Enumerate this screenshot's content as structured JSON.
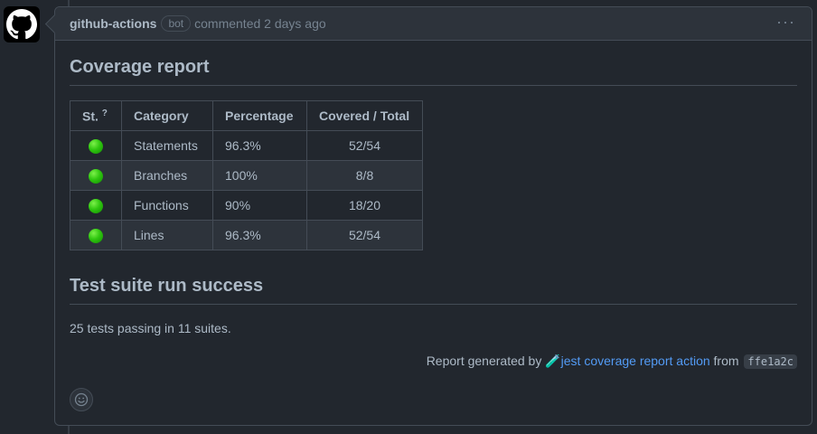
{
  "comment": {
    "author": "github-actions",
    "badge": "bot",
    "meta": "commented 2 days ago",
    "menu_label": "···"
  },
  "coverage": {
    "title": "Coverage report",
    "headers": {
      "status": "St.",
      "status_help": "?",
      "category": "Category",
      "percentage": "Percentage",
      "covered_total": "Covered / Total"
    },
    "rows": [
      {
        "category": "Statements",
        "percentage": "96.3%",
        "covered": "52/54",
        "status_color": "#2fc70f"
      },
      {
        "category": "Branches",
        "percentage": "100%",
        "covered": "8/8",
        "status_color": "#2fc70f"
      },
      {
        "category": "Functions",
        "percentage": "90%",
        "covered": "18/20",
        "status_color": "#2fc70f"
      },
      {
        "category": "Lines",
        "percentage": "96.3%",
        "covered": "52/54",
        "status_color": "#2fc70f"
      }
    ]
  },
  "tests": {
    "title": "Test suite run success",
    "summary": "25 tests passing in 11 suites."
  },
  "footer": {
    "prefix": "Report generated by ",
    "icon": "test-tube-icon",
    "link_text": "jest coverage report action",
    "middle": " from ",
    "commit": "ffe1a2c"
  },
  "colors": {
    "background": "#22272e",
    "header_bg": "#2d333b",
    "border": "#444c56",
    "link": "#539bf5",
    "status_ok": "#2fc70f"
  }
}
